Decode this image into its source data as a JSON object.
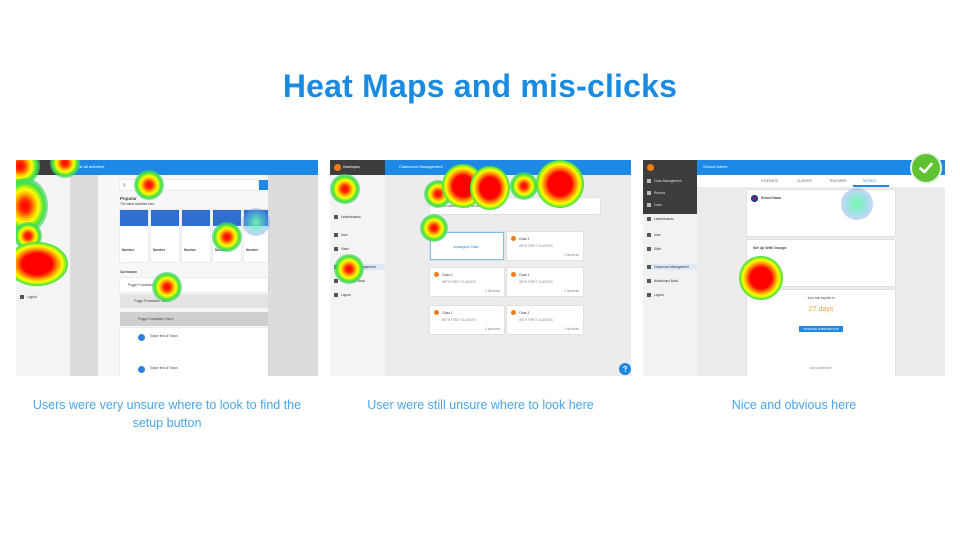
{
  "slide": {
    "title": "Heat Maps and mis-clicks"
  },
  "screenshot_1": {
    "topbar_title": "ome all activities",
    "search_placeholder": "Q",
    "section_popular": "Popular",
    "section_popular_sub": "The latest activities here",
    "tile_label": "Number",
    "section_curriculum": "Curriculum",
    "row_1": "Puggo Foundation Vision",
    "row_2": "Puggo Foundation Vision",
    "row_3": "Puggo Foundation Vision",
    "item_label": "Graph test of Vision",
    "logout": "Logout"
  },
  "screenshot_2": {
    "topbar_title": "Classroom Management",
    "account": "Dashtopics",
    "nav_items": [
      "Leaderboards",
      "User",
      "Video",
      "Classroom Management",
      "Workshops Book",
      "Logout"
    ],
    "hint": "Tap on a class to manage its settings",
    "card_add_label": "Unassigned Class",
    "class_label": "Class 1",
    "class_meta": "WITH FIRST CLASSES",
    "class_count": "0 students"
  },
  "screenshot_3": {
    "topbar_title": "School Admin",
    "tabs": [
      "STUDENTS",
      "CLASSES",
      "TEACHERS",
      "SCHOOL"
    ],
    "nav_items": [
      "Class Management",
      "Reports",
      "Video",
      "Leaderboards",
      "User",
      "Slide",
      "Classroom Management",
      "Workshops Book",
      "Logout"
    ],
    "school_name": "School Name",
    "setup_title": "Set Up With Google",
    "trial_label": "Your trial expires in",
    "trial_days": "27 days",
    "upgrade_button": "UPGRADE SUBSCRIPTION",
    "footer_help": "Any questions?"
  },
  "captions": [
    "Users were very unsure where to look to find the setup button",
    "User were still unsure where to look here",
    "Nice and obvious here"
  ],
  "colors": {
    "title": "#1a8be0",
    "caption": "#4aa6e8",
    "app_blue": "#1e88e5",
    "accent_orange": "#ef7d1a",
    "success_green": "#5fc232"
  }
}
